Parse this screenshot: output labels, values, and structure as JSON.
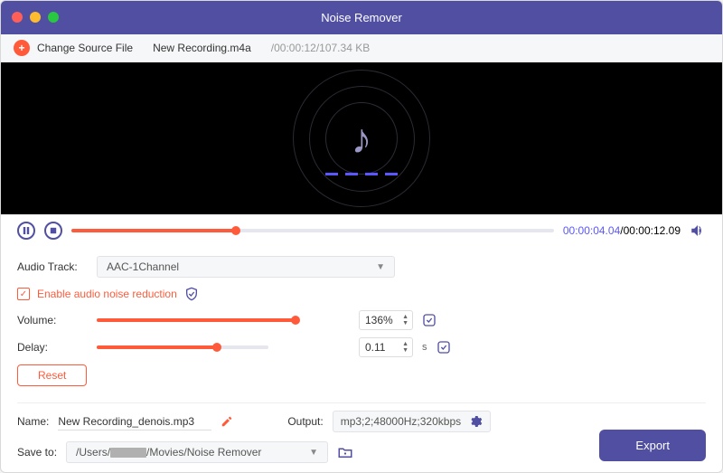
{
  "window": {
    "title": "Noise Remover"
  },
  "topbar": {
    "change_label": "Change Source File",
    "filename": "New Recording.m4a",
    "fileinfo": "/00:00:12/107.34 KB"
  },
  "playback": {
    "current_time": "00:00:04.04",
    "total_time": "00:00:12.09",
    "progress_pct": 34
  },
  "audio_track": {
    "label": "Audio Track:",
    "value": "AAC-1Channel"
  },
  "noise_reduction": {
    "checked": true,
    "label": "Enable audio noise reduction"
  },
  "volume": {
    "label": "Volume:",
    "value": "136%",
    "slider_pct": 100
  },
  "delay": {
    "label": "Delay:",
    "value": "0.11",
    "unit": "s",
    "slider_pct": 70
  },
  "reset_label": "Reset",
  "output_row": {
    "name_label": "Name:",
    "name_value": "New Recording_denois.mp3",
    "output_label": "Output:",
    "output_value": "mp3;2;48000Hz;320kbps"
  },
  "save_row": {
    "label": "Save to:",
    "path_prefix": "/Users/",
    "path_suffix": "/Movies/Noise Remover"
  },
  "export_label": "Export"
}
